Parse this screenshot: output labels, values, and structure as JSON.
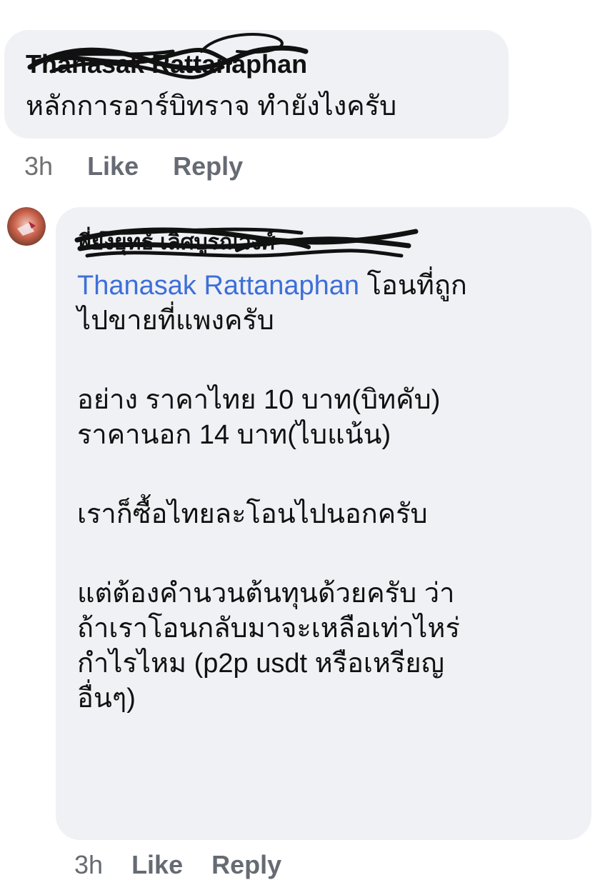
{
  "comment": {
    "author": "Thanasak Rattanaphan",
    "text": "หลักการอาร์บิทราจ ทำยังไงครับ",
    "time": "3h",
    "like_label": "Like",
    "reply_label": "Reply"
  },
  "reply": {
    "author": "พี่ยงยุทธ์ เลิศบูรณวงศ์",
    "mention": "Thanasak Rattanaphan",
    "lines": [
      "โอนที่ถูก",
      "ไปขายที่แพงครับ",
      "อย่าง ราคาไทย 10 บาท(บิทคับ)",
      "ราคานอก 14 บาท(ไบแน้น)",
      "เราก็ซื้อไทยละโอนไปนอกครับ",
      "แต่ต้องคำนวนต้นทุนด้วยครับ ว่า",
      "ถ้าเราโอนกลับมาจะเหลือเท่าไหร่",
      "กำไรไหม (p2p usdt หรือเหรียญ",
      "อื่นๆ)"
    ],
    "time": "3h",
    "like_label": "Like",
    "reply_label": "Reply"
  },
  "icons": {
    "avatar": "user-avatar"
  }
}
